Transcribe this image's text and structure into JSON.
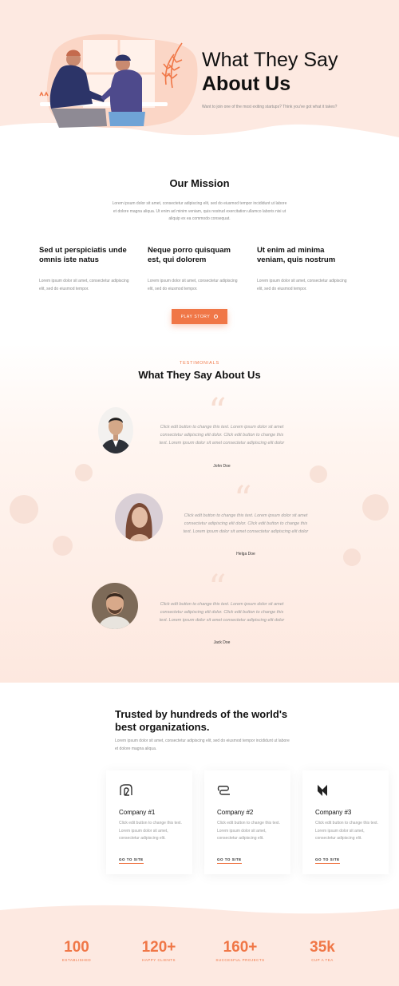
{
  "hero": {
    "title_line1": "What They Say",
    "title_line2": "About Us",
    "subtitle": "Want to join one of the most exiting startups? Think you've got what it takes?"
  },
  "mission": {
    "title": "Our Mission",
    "text": "Lorem ipsum dolor sit amet, consectetur adipiscing elit, sed do eiusmod tempor incididunt ut labore et dolore magna aliqua. Ut enim ad minim veniam, quis nostrud exercitation ullamco laboris nisi ut aliquip ex ea commodo consequat.",
    "features": [
      {
        "title": "Sed ut perspiciatis unde omnis iste natus",
        "text": "Lorem ipsum dolor sit amet, consectetur adipiscing elit, sed do eiusmod tempor."
      },
      {
        "title": "Neque porro quisquam est, qui dolorem",
        "text": "Lorem ipsum dolor sit amet, consectetur adipiscing elit, sed do eiusmod tempor."
      },
      {
        "title": "Ut enim ad minima veniam, quis nostrum",
        "text": "Lorem ipsum dolor sit amet, consectetur adipiscing elit, sed do eiusmod tempor."
      }
    ],
    "button_label": "PLAY STORY"
  },
  "testimonials": {
    "kicker": "TESTIMONIALS",
    "title": "What They Say About Us",
    "items": [
      {
        "text": "Click edit button to change this text. Lorem ipsum dolor sit amet consectetur adipiscing elit dolor. Click edit button to change this text. Lorem ipsum dolor sit amet consectetur adipiscing elit dolor",
        "name": "John Doe"
      },
      {
        "text": "Click edit button to change this text. Lorem ipsum dolor sit amet consectetur adipiscing elit dolor. Click edit button to change this text. Lorem ipsum dolor sit amet consectetur adipiscing elit dolor",
        "name": "Helga Doe"
      },
      {
        "text": "Click edit button to change this text. Lorem ipsum dolor sit amet consectetur adipiscing elit dolor. Click edit button to change this text. Lorem ipsum dolor sit amet consectetur adipiscing elit dolor",
        "name": "Jack Doe"
      }
    ]
  },
  "trusted": {
    "title": "Trusted by hundreds of the world's best organizations.",
    "text": "Lorem ipsum dolor sit amet, consectetur adipiscing elit, sed do eiusmod tempor incididunt ut labore et dolore magna aliqua.",
    "companies": [
      {
        "name": "Company #1",
        "text": "Click edit button to change this text. Lorem ipsum dolor sit amet, consectetur adipiscing elit.",
        "link": "GO TO SITE",
        "icon": "outline-logo-icon"
      },
      {
        "name": "Company #2",
        "text": "Click edit button to change this text. Lorem ipsum dolor sit amet, consectetur adipiscing elit.",
        "link": "GO TO SITE",
        "icon": "loop-logo-icon"
      },
      {
        "name": "Company #3",
        "text": "Click edit button to change this text. Lorem ipsum dolor sit amet, consectetur adipiscing elit.",
        "link": "GO TO SITE",
        "icon": "n-logo-icon"
      }
    ]
  },
  "stats": [
    {
      "number": "100",
      "label": "ESTABLISHED"
    },
    {
      "number": "120+",
      "label": "HAPPY CLIENTS"
    },
    {
      "number": "160+",
      "label": "SUCCESFUL PROJECTS"
    },
    {
      "number": "35k",
      "label": "CUP A TEA"
    }
  ],
  "colors": {
    "accent": "#f07747",
    "hero_bg": "#fde9e1",
    "heading": "#111111",
    "muted": "#8a8a8a"
  }
}
